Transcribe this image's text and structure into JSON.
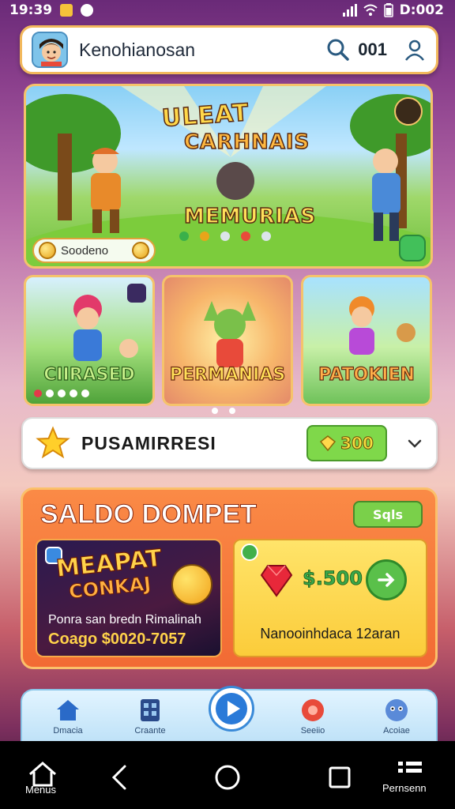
{
  "status_bar": {
    "time": "19:39",
    "battery_text": "D:002"
  },
  "header": {
    "username": "Kenohianosan",
    "coin_count": "001"
  },
  "hero": {
    "title_line1": "ULEAT",
    "title_line2": "CARHNAIS",
    "title_line3": "MEMURIAS",
    "badge_label": "Soodeno"
  },
  "cards": [
    {
      "label": "CIIRASED"
    },
    {
      "label": "PERMANIAS"
    },
    {
      "label": "PATOKIEN"
    }
  ],
  "featured": {
    "label": "PUSAMIRRESI",
    "pill_value": "300"
  },
  "wallet": {
    "title": "SALDO DOMPET",
    "action_label": "Sqls",
    "promo": {
      "title_line1": "MEAPAT",
      "title_line2": "CONKAJ",
      "description": "Ponra san bredn Rimalinah",
      "code": "Coago $0020-7057"
    },
    "balance": {
      "value": "$.500",
      "description": "Nanooinhdaca 12aran"
    }
  },
  "bottom_nav": [
    {
      "label": "Dmacia"
    },
    {
      "label": "Craante"
    },
    {
      "label": "Seeiio"
    },
    {
      "label": "Acoiae"
    }
  ],
  "system_nav": {
    "home_label": "Menus",
    "menu_label": "Pernsenn"
  },
  "colors": {
    "accent_orange": "#f26a34",
    "accent_green": "#7ad04a",
    "gold": "#f5c36b"
  }
}
